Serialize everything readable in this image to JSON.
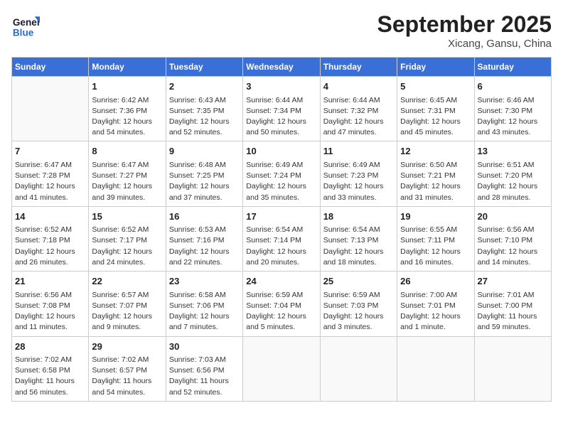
{
  "header": {
    "logo": "GeneralBlue",
    "logo_general": "General",
    "logo_blue": "Blue",
    "month": "September 2025",
    "location": "Xicang, Gansu, China"
  },
  "days_of_week": [
    "Sunday",
    "Monday",
    "Tuesday",
    "Wednesday",
    "Thursday",
    "Friday",
    "Saturday"
  ],
  "weeks": [
    [
      {
        "day": "",
        "sunrise": "",
        "sunset": "",
        "daylight": ""
      },
      {
        "day": "1",
        "sunrise": "Sunrise: 6:42 AM",
        "sunset": "Sunset: 7:36 PM",
        "daylight": "Daylight: 12 hours and 54 minutes."
      },
      {
        "day": "2",
        "sunrise": "Sunrise: 6:43 AM",
        "sunset": "Sunset: 7:35 PM",
        "daylight": "Daylight: 12 hours and 52 minutes."
      },
      {
        "day": "3",
        "sunrise": "Sunrise: 6:44 AM",
        "sunset": "Sunset: 7:34 PM",
        "daylight": "Daylight: 12 hours and 50 minutes."
      },
      {
        "day": "4",
        "sunrise": "Sunrise: 6:44 AM",
        "sunset": "Sunset: 7:32 PM",
        "daylight": "Daylight: 12 hours and 47 minutes."
      },
      {
        "day": "5",
        "sunrise": "Sunrise: 6:45 AM",
        "sunset": "Sunset: 7:31 PM",
        "daylight": "Daylight: 12 hours and 45 minutes."
      },
      {
        "day": "6",
        "sunrise": "Sunrise: 6:46 AM",
        "sunset": "Sunset: 7:30 PM",
        "daylight": "Daylight: 12 hours and 43 minutes."
      }
    ],
    [
      {
        "day": "7",
        "sunrise": "Sunrise: 6:47 AM",
        "sunset": "Sunset: 7:28 PM",
        "daylight": "Daylight: 12 hours and 41 minutes."
      },
      {
        "day": "8",
        "sunrise": "Sunrise: 6:47 AM",
        "sunset": "Sunset: 7:27 PM",
        "daylight": "Daylight: 12 hours and 39 minutes."
      },
      {
        "day": "9",
        "sunrise": "Sunrise: 6:48 AM",
        "sunset": "Sunset: 7:25 PM",
        "daylight": "Daylight: 12 hours and 37 minutes."
      },
      {
        "day": "10",
        "sunrise": "Sunrise: 6:49 AM",
        "sunset": "Sunset: 7:24 PM",
        "daylight": "Daylight: 12 hours and 35 minutes."
      },
      {
        "day": "11",
        "sunrise": "Sunrise: 6:49 AM",
        "sunset": "Sunset: 7:23 PM",
        "daylight": "Daylight: 12 hours and 33 minutes."
      },
      {
        "day": "12",
        "sunrise": "Sunrise: 6:50 AM",
        "sunset": "Sunset: 7:21 PM",
        "daylight": "Daylight: 12 hours and 31 minutes."
      },
      {
        "day": "13",
        "sunrise": "Sunrise: 6:51 AM",
        "sunset": "Sunset: 7:20 PM",
        "daylight": "Daylight: 12 hours and 28 minutes."
      }
    ],
    [
      {
        "day": "14",
        "sunrise": "Sunrise: 6:52 AM",
        "sunset": "Sunset: 7:18 PM",
        "daylight": "Daylight: 12 hours and 26 minutes."
      },
      {
        "day": "15",
        "sunrise": "Sunrise: 6:52 AM",
        "sunset": "Sunset: 7:17 PM",
        "daylight": "Daylight: 12 hours and 24 minutes."
      },
      {
        "day": "16",
        "sunrise": "Sunrise: 6:53 AM",
        "sunset": "Sunset: 7:16 PM",
        "daylight": "Daylight: 12 hours and 22 minutes."
      },
      {
        "day": "17",
        "sunrise": "Sunrise: 6:54 AM",
        "sunset": "Sunset: 7:14 PM",
        "daylight": "Daylight: 12 hours and 20 minutes."
      },
      {
        "day": "18",
        "sunrise": "Sunrise: 6:54 AM",
        "sunset": "Sunset: 7:13 PM",
        "daylight": "Daylight: 12 hours and 18 minutes."
      },
      {
        "day": "19",
        "sunrise": "Sunrise: 6:55 AM",
        "sunset": "Sunset: 7:11 PM",
        "daylight": "Daylight: 12 hours and 16 minutes."
      },
      {
        "day": "20",
        "sunrise": "Sunrise: 6:56 AM",
        "sunset": "Sunset: 7:10 PM",
        "daylight": "Daylight: 12 hours and 14 minutes."
      }
    ],
    [
      {
        "day": "21",
        "sunrise": "Sunrise: 6:56 AM",
        "sunset": "Sunset: 7:08 PM",
        "daylight": "Daylight: 12 hours and 11 minutes."
      },
      {
        "day": "22",
        "sunrise": "Sunrise: 6:57 AM",
        "sunset": "Sunset: 7:07 PM",
        "daylight": "Daylight: 12 hours and 9 minutes."
      },
      {
        "day": "23",
        "sunrise": "Sunrise: 6:58 AM",
        "sunset": "Sunset: 7:06 PM",
        "daylight": "Daylight: 12 hours and 7 minutes."
      },
      {
        "day": "24",
        "sunrise": "Sunrise: 6:59 AM",
        "sunset": "Sunset: 7:04 PM",
        "daylight": "Daylight: 12 hours and 5 minutes."
      },
      {
        "day": "25",
        "sunrise": "Sunrise: 6:59 AM",
        "sunset": "Sunset: 7:03 PM",
        "daylight": "Daylight: 12 hours and 3 minutes."
      },
      {
        "day": "26",
        "sunrise": "Sunrise: 7:00 AM",
        "sunset": "Sunset: 7:01 PM",
        "daylight": "Daylight: 12 hours and 1 minute."
      },
      {
        "day": "27",
        "sunrise": "Sunrise: 7:01 AM",
        "sunset": "Sunset: 7:00 PM",
        "daylight": "Daylight: 11 hours and 59 minutes."
      }
    ],
    [
      {
        "day": "28",
        "sunrise": "Sunrise: 7:02 AM",
        "sunset": "Sunset: 6:58 PM",
        "daylight": "Daylight: 11 hours and 56 minutes."
      },
      {
        "day": "29",
        "sunrise": "Sunrise: 7:02 AM",
        "sunset": "Sunset: 6:57 PM",
        "daylight": "Daylight: 11 hours and 54 minutes."
      },
      {
        "day": "30",
        "sunrise": "Sunrise: 7:03 AM",
        "sunset": "Sunset: 6:56 PM",
        "daylight": "Daylight: 11 hours and 52 minutes."
      },
      {
        "day": "",
        "sunrise": "",
        "sunset": "",
        "daylight": ""
      },
      {
        "day": "",
        "sunrise": "",
        "sunset": "",
        "daylight": ""
      },
      {
        "day": "",
        "sunrise": "",
        "sunset": "",
        "daylight": ""
      },
      {
        "day": "",
        "sunrise": "",
        "sunset": "",
        "daylight": ""
      }
    ]
  ]
}
